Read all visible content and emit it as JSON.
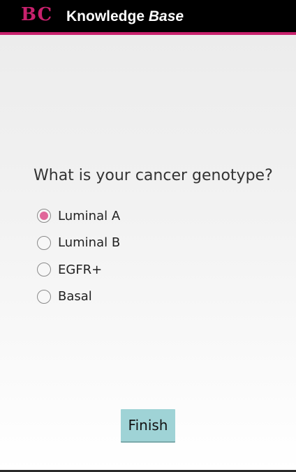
{
  "header": {
    "logo_text": "BC",
    "title_plain": "Knowledge",
    "title_italic": "Base"
  },
  "colors": {
    "header_background": "#000000",
    "brand_accent": "#c8216d",
    "radio_selected": "#e0679a",
    "button_background": "#9fd3d6"
  },
  "question": {
    "text": "What is your cancer genotype?"
  },
  "options": [
    {
      "label": "Luminal A",
      "selected": true
    },
    {
      "label": "Luminal B",
      "selected": false
    },
    {
      "label": "EGFR+",
      "selected": false
    },
    {
      "label": "Basal",
      "selected": false
    }
  ],
  "finish_button": {
    "label": "Finish"
  }
}
